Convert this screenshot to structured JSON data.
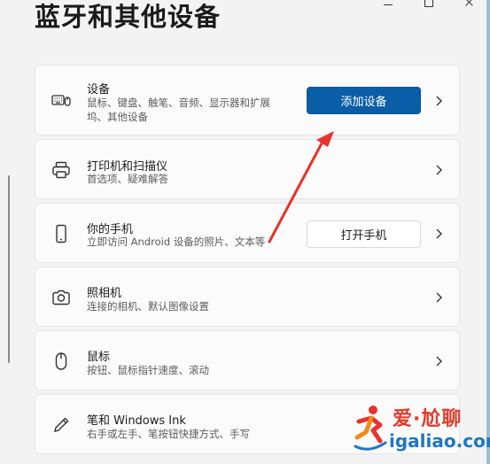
{
  "page": {
    "title": "蓝牙和其他设备"
  },
  "cards": [
    {
      "id": "devices",
      "icon": "keyboard-mouse-icon",
      "title": "设备",
      "subtitle_lines": [
        "鼠标、键盘、触笔、音频、显示器和扩展",
        "坞、其他设备"
      ],
      "button": "添加设备"
    },
    {
      "id": "printers",
      "icon": "printer-icon",
      "title": "打印机和扫描仪",
      "subtitle_lines": [
        "首选项、疑难解答"
      ]
    },
    {
      "id": "phone",
      "icon": "phone-icon",
      "title": "你的手机",
      "subtitle_lines": [
        "立即访问 Android 设备的照片、文本等"
      ],
      "button": "打开手机"
    },
    {
      "id": "camera",
      "icon": "camera-icon",
      "title": "照相机",
      "subtitle_lines": [
        "连接的相机、默认图像设置"
      ]
    },
    {
      "id": "mouse",
      "icon": "mouse-icon",
      "title": "鼠标",
      "subtitle_lines": [
        "按钮、鼠标指针速度、滚动"
      ]
    },
    {
      "id": "pen",
      "icon": "pen-icon",
      "title": "笔和 Windows Ink",
      "subtitle_lines": [
        "右手或左手、笔按钮快捷方式、手写"
      ]
    }
  ],
  "watermark": {
    "title": "爱·尬聊",
    "url": "igaliao.com"
  },
  "colors": {
    "accent": "#0a5ea8",
    "annotation_arrow": "#e8322b",
    "background": "#f3f3f3",
    "card": "#fbfbfb"
  }
}
